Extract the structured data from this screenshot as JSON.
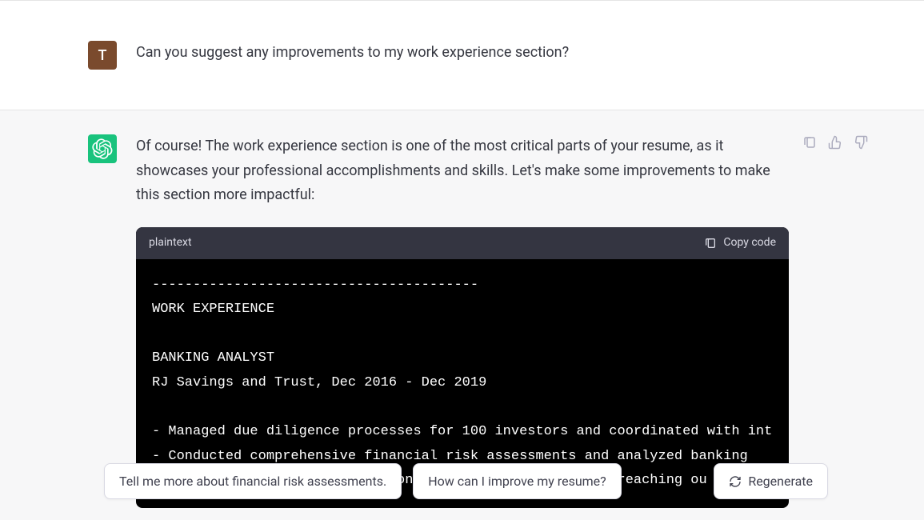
{
  "user": {
    "avatar_letter": "T",
    "message": "Can you suggest any improvements to my work experience section?"
  },
  "assistant": {
    "intro": "Of course! The work experience section is one of the most critical parts of your resume, as it showcases your professional accomplishments and skills. Let's make some improvements to make this section more impactful:",
    "code_lang": "plaintext",
    "copy_label": "Copy code",
    "code_content": "----------------------------------------\nWORK EXPERIENCE\n\nBANKING ANALYST\nRJ Savings and Trust, Dec 2016 - Dec 2019\n\n- Managed due diligence processes for 100 investors and coordinated with int\n- Conducted comprehensive financial risk assessments and analyzed banking\n- Strengthened investor relations and business growth by reaching ou"
  },
  "suggestions": {
    "chip1": "Tell me more about financial risk assessments.",
    "chip2": "How can I improve my resume?",
    "regenerate": "Regenerate"
  }
}
